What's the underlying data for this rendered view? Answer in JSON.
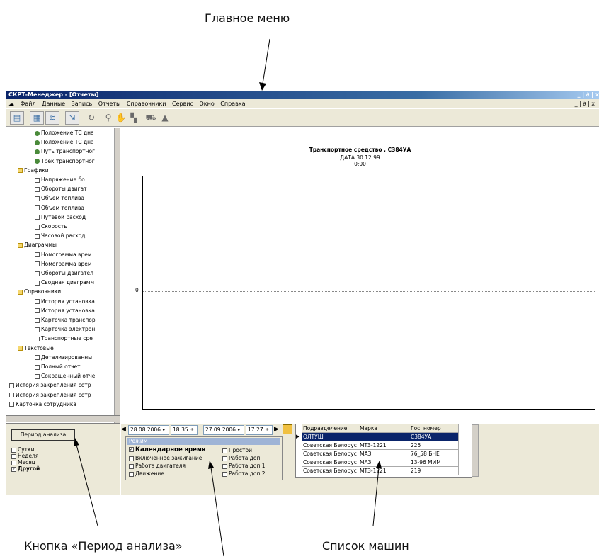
{
  "annotations": {
    "main_menu": "Главное меню",
    "period_button": "Кнопка «Период анализа»",
    "vehicle_list": "Список  машин"
  },
  "window": {
    "title": "СКРТ-Менеджер - [Отчеты]",
    "controls": "_ | ∂ | x",
    "menu": [
      "Файл",
      "Данные",
      "Запись",
      "Отчеты",
      "Справочники",
      "Сервис",
      "Окно",
      "Справка"
    ]
  },
  "tree": [
    {
      "label": "Положение ТС дна",
      "icon": "gear-icon",
      "indent": 3
    },
    {
      "label": "Положение ТС дна",
      "icon": "gear-icon",
      "indent": 3
    },
    {
      "label": "Путь транспортног",
      "icon": "gear-icon",
      "indent": 3
    },
    {
      "label": "Трек транспортног",
      "icon": "gear-icon",
      "indent": 3
    },
    {
      "label": "Графики",
      "icon": "folder-icon",
      "indent": 1
    },
    {
      "label": "Напряжение бо",
      "icon": "checkbox-icon",
      "indent": 3
    },
    {
      "label": "Обороты двигат",
      "icon": "checkbox-icon",
      "indent": 3
    },
    {
      "label": "Объем топлива",
      "icon": "checkbox-icon",
      "indent": 3
    },
    {
      "label": "Объем топлива",
      "icon": "checkbox-icon",
      "indent": 3
    },
    {
      "label": "Путевой расход",
      "icon": "checkbox-icon",
      "indent": 3
    },
    {
      "label": "Скорость",
      "icon": "checkbox-icon",
      "indent": 3
    },
    {
      "label": "Часовой расход",
      "icon": "checkbox-icon",
      "indent": 3
    },
    {
      "label": "Диаграммы",
      "icon": "folder-icon",
      "indent": 1
    },
    {
      "label": "Номограмма врем",
      "icon": "doc-icon",
      "indent": 3
    },
    {
      "label": "Номограмма врем",
      "icon": "doc-icon",
      "indent": 3
    },
    {
      "label": "Обороты двигател",
      "icon": "doc-icon",
      "indent": 3
    },
    {
      "label": "Сводная диаграмм",
      "icon": "doc-icon",
      "indent": 3
    },
    {
      "label": "Справочники",
      "icon": "folder-icon",
      "indent": 1
    },
    {
      "label": "История установка",
      "icon": "doc-icon",
      "indent": 3
    },
    {
      "label": "История установка",
      "icon": "doc-icon",
      "indent": 3
    },
    {
      "label": "Карточка транспор",
      "icon": "doc-icon",
      "indent": 3
    },
    {
      "label": "Карточка электрон",
      "icon": "doc-icon",
      "indent": 3
    },
    {
      "label": "Транспортные сре",
      "icon": "doc-icon",
      "indent": 3
    },
    {
      "label": "Текстовые",
      "icon": "folder-icon",
      "indent": 1
    },
    {
      "label": "Детализированны",
      "icon": "doc-icon",
      "indent": 3
    },
    {
      "label": "Полный отчет",
      "icon": "doc-icon",
      "indent": 3
    },
    {
      "label": "Сокращенный отче",
      "icon": "doc-icon",
      "indent": 3
    },
    {
      "label": "История закрепления сотр",
      "icon": "doc-icon",
      "indent": 0
    },
    {
      "label": "История закрепления сотр",
      "icon": "doc-icon",
      "indent": 0
    },
    {
      "label": "Карточка сотрудника",
      "icon": "doc-icon",
      "indent": 0
    }
  ],
  "period": {
    "button": "Период анализа",
    "options": [
      {
        "label": "Сутки",
        "checked": false
      },
      {
        "label": "Неделя",
        "checked": false
      },
      {
        "label": "Месяц",
        "checked": false
      },
      {
        "label": "Другой",
        "checked": true
      }
    ]
  },
  "chart": {
    "title": "Транспортное средство , С384УА",
    "date": "ДАТА 30.12.99",
    "time": "0:00",
    "ytick": "0"
  },
  "range": {
    "start_date": "28.08.2006",
    "start_time": "18:35",
    "end_date": "27.09.2006",
    "end_time": "17:27"
  },
  "mode": {
    "title": "Режим",
    "items": [
      {
        "label": "Календарное время",
        "checked": true,
        "bold": true
      },
      {
        "label": "Простой",
        "checked": false
      },
      {
        "label": "Включенное зажигание",
        "checked": false
      },
      {
        "label": "Работа доп",
        "checked": false
      },
      {
        "label": "Работа двигателя",
        "checked": false
      },
      {
        "label": "Работа доп 1",
        "checked": false
      },
      {
        "label": "Движение",
        "checked": false
      },
      {
        "label": "Работа доп 2",
        "checked": false
      }
    ]
  },
  "vehicles": {
    "columns": [
      "Подразделение",
      "Марка",
      "Гос. номер"
    ],
    "rows": [
      [
        "ОЛТУШ",
        "",
        "С384УА"
      ],
      [
        "Советская Белорус",
        "МТЗ-1221",
        "225"
      ],
      [
        "Советская Белорус",
        "МАЗ",
        "76_58 БНЕ"
      ],
      [
        "Советская Белорус",
        "МАЗ",
        "13-96 МИМ"
      ],
      [
        "Советская Белорус",
        "МТЗ-1221",
        "219"
      ]
    ]
  }
}
